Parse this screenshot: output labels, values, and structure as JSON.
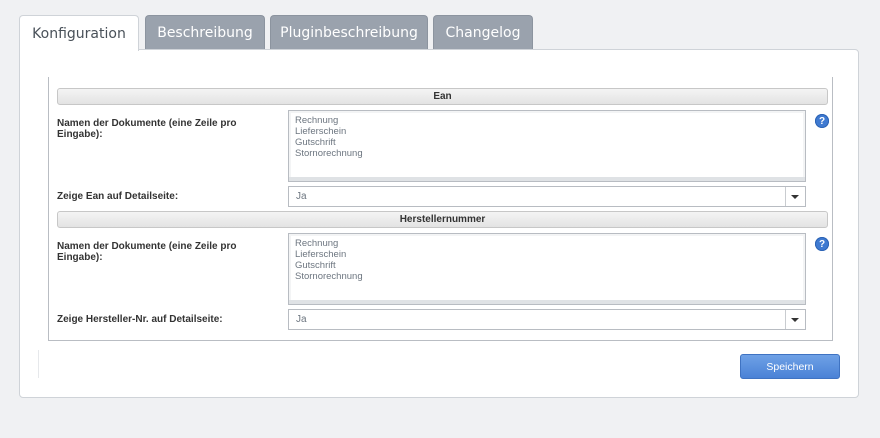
{
  "tabs": [
    {
      "label": "Konfiguration",
      "active": true
    },
    {
      "label": "Beschreibung",
      "active": false
    },
    {
      "label": "Pluginbeschreibung",
      "active": false
    },
    {
      "label": "Changelog",
      "active": false
    }
  ],
  "sections": [
    {
      "header": "Ean",
      "documents_label": "Namen der Dokumente (eine Zeile pro Eingabe):",
      "documents": [
        "Rechnung",
        "Lieferschein",
        "Gutschrift",
        "Stornorechnung"
      ],
      "select_label": "Zeige Ean auf Detailseite:",
      "select_value": "Ja"
    },
    {
      "header": "Herstellernummer",
      "documents_label": "Namen der Dokumente (eine Zeile pro Eingabe):",
      "documents": [
        "Rechnung",
        "Lieferschein",
        "Gutschrift",
        "Stornorechnung"
      ],
      "select_label": "Zeige Hersteller-Nr. auf Detailseite:",
      "select_value": "Ja"
    }
  ],
  "help_symbol": "?",
  "save_label": "Speichern",
  "icons": {
    "help": "help-icon",
    "dropdown": "chevron-down-icon"
  },
  "colors": {
    "tab_inactive": "#9aa2ad",
    "help": "#3f7ad1",
    "save": "#4a82d6"
  }
}
